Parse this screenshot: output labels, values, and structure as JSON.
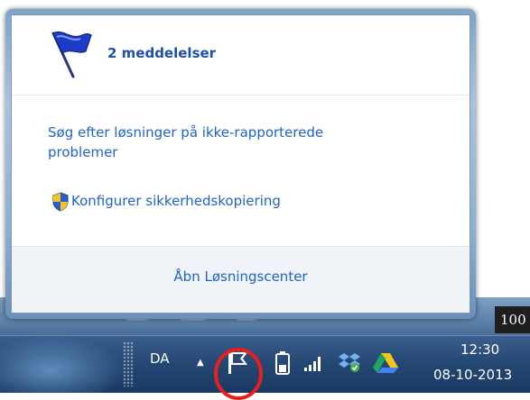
{
  "popup": {
    "count_label": "2 meddelelser",
    "link_1": "Søg efter løsninger på ikke-rapporterede problemer",
    "link_2": "Konfigurer sikkerhedskopiering",
    "footer_link": "Åbn Løsningscenter"
  },
  "desktop": {
    "zoom_fragment": "100"
  },
  "taskbar": {
    "language": "DA",
    "show_hidden_arrow": "▲",
    "time": "12:30",
    "date": "08-10-2013"
  },
  "icons": {
    "flag": "flag-icon",
    "shield": "uac-shield-icon",
    "battery": "battery-icon",
    "signal": "signal-icon",
    "dropbox": "dropbox-icon",
    "google_drive": "google-drive-icon"
  },
  "colors": {
    "link": "#1e64c8",
    "highlight_ring": "#e8201c",
    "taskbar": "#254874"
  }
}
